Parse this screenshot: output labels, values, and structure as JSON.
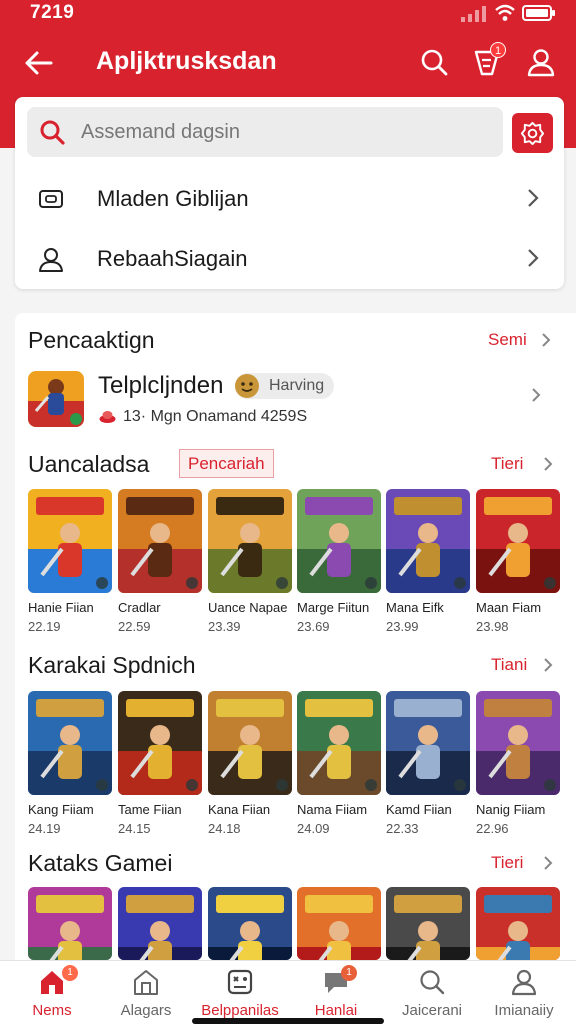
{
  "status_bar": {
    "time": "7219"
  },
  "app_bar": {
    "title": "Apljktrusksdan",
    "notif_badge": "1"
  },
  "search": {
    "placeholder": "Assemand dagsin"
  },
  "menu_items": [
    {
      "label": "Mladen Giblijan",
      "icon": "folder-icon"
    },
    {
      "label": "RebaahSiagain",
      "icon": "user-icon"
    }
  ],
  "featured": {
    "title": "Pencaaktign",
    "link": "Semi",
    "app_name": "Telplcljnden",
    "pill": "Harving",
    "sub": "13· Mgn Onamand 4259S"
  },
  "sections": [
    {
      "title": "Uancaladsa",
      "tag": "Pencariah",
      "link": "Tieri",
      "items": [
        {
          "name": "Hanie Fiian",
          "size": "22.19",
          "colors": [
            "#f0b020",
            "#2a7bd6",
            "#d9372a"
          ]
        },
        {
          "name": "Cradlar",
          "size": "22.59",
          "colors": [
            "#d57b22",
            "#b3312a",
            "#5a2a12"
          ]
        },
        {
          "name": "Uance Napae",
          "size": "23.39",
          "colors": [
            "#e3a23a",
            "#6a7a2a",
            "#3a2a12"
          ]
        },
        {
          "name": "Marge Fiitun",
          "size": "23.69",
          "colors": [
            "#6fa35a",
            "#3a6a3a",
            "#8a4ab0"
          ]
        },
        {
          "name": "Mana Eifk",
          "size": "23.99",
          "colors": [
            "#6a4ab6",
            "#2a3a8a",
            "#c09030"
          ]
        },
        {
          "name": "Maan Fiam",
          "size": "23.98",
          "colors": [
            "#c9252a",
            "#7a120f",
            "#f0a030"
          ]
        }
      ]
    },
    {
      "title": "Karakai Spdnich",
      "link": "Tiani",
      "items": [
        {
          "name": "Kang Fiiam",
          "size": "24.19",
          "colors": [
            "#2a6ab0",
            "#1a3a6a",
            "#d0a040"
          ]
        },
        {
          "name": "Tame Fiian",
          "size": "24.15",
          "colors": [
            "#3a2a1a",
            "#b32a1a",
            "#e3b030"
          ]
        },
        {
          "name": "Kana Fiian",
          "size": "24.18",
          "colors": [
            "#c08030",
            "#3a2a1a",
            "#e3c040"
          ]
        },
        {
          "name": "Nama Fiiam",
          "size": "24.09",
          "colors": [
            "#3a7a4a",
            "#6a4a2a",
            "#e3c040"
          ]
        },
        {
          "name": "Kamd Fiian",
          "size": "22.33",
          "colors": [
            "#3a5a9a",
            "#1a2a4a",
            "#9ab0d0"
          ]
        },
        {
          "name": "Nanig Fiiam",
          "size": "22.96",
          "colors": [
            "#8a4ab0",
            "#4a2a6a",
            "#c08040"
          ]
        }
      ]
    },
    {
      "title": "Kataks Gamei",
      "link": "Tieri",
      "items": [
        {
          "colors": [
            "#b03a9a",
            "#3a6a4a",
            "#e3c040"
          ]
        },
        {
          "colors": [
            "#3a3ab0",
            "#1a1a5a",
            "#d0a040"
          ]
        },
        {
          "colors": [
            "#2a4a8a",
            "#0a1a3a",
            "#f0d040"
          ]
        },
        {
          "colors": [
            "#e3702a",
            "#b31a1a",
            "#f0c040"
          ]
        },
        {
          "colors": [
            "#4a4a4a",
            "#1a1a1a",
            "#d0a040"
          ]
        },
        {
          "colors": [
            "#c9302a",
            "#f0a030",
            "#3a7ab0"
          ]
        }
      ]
    }
  ],
  "bottom_nav": [
    {
      "label": "Nems",
      "icon": "home-icon",
      "active": true,
      "badge": "1"
    },
    {
      "label": "Alagars",
      "icon": "store-icon"
    },
    {
      "label": "Belppanilas",
      "icon": "game-icon",
      "highlight": true
    },
    {
      "label": "Hanlai",
      "icon": "chat-icon",
      "badge": "1",
      "highlight": true
    },
    {
      "label": "Jaicerani",
      "icon": "search-icon"
    },
    {
      "label": "Imianaiiy",
      "icon": "profile-icon"
    }
  ],
  "colors": {
    "brand": "#d8232f",
    "background": "#f4f4f4"
  }
}
